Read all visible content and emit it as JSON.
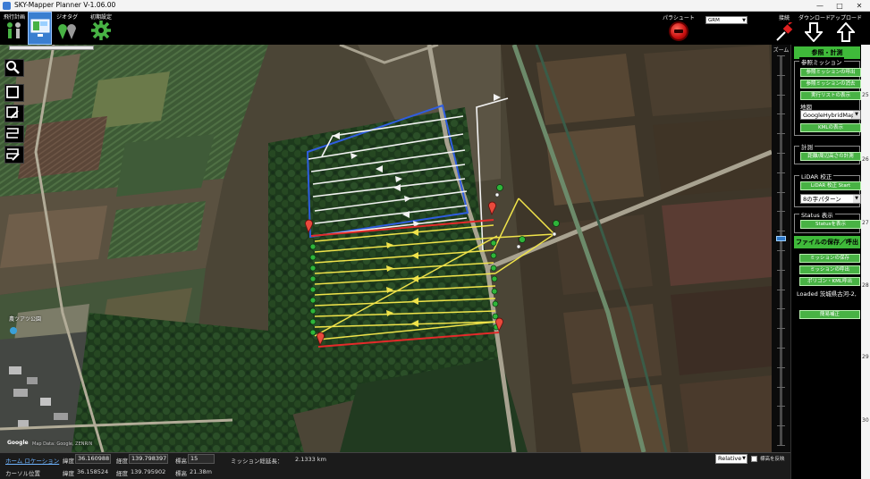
{
  "window": {
    "title": "SKY-Mapper Planner  V-1.06.00",
    "controls": [
      "—",
      "□",
      "✕"
    ]
  },
  "toolbar": {
    "tabs": [
      {
        "label": "飛行計画",
        "icon": "people-pin-icon"
      },
      {
        "label": "",
        "icon": "monitor-icon"
      },
      {
        "label": "ジオタグ",
        "icon": "geotag-pins-icon"
      },
      {
        "label": "初期設定",
        "icon": "gear-icon"
      }
    ],
    "parachute_label": "パラシュート",
    "mode_value": "GRM",
    "connect_label": "接続",
    "download_label": "ダウンロード",
    "upload_label": "アップロード"
  },
  "map": {
    "place_label": "農ツアツ公園",
    "google_label": "Google",
    "attribution": "Map Data: Google, ZENRIN"
  },
  "zoom": {
    "label": "ズーム",
    "level": 0.53
  },
  "panel": {
    "header": "参照・計測",
    "ref_group": {
      "title": "参照ミッション",
      "load_button": "参照ミッションの呼出",
      "clear_button": "参照ミッションの消去",
      "list_button": "実行リストの表示",
      "map_label": "地図",
      "map_select": "GoogleHybridMap",
      "kml_button": "KMLの表示"
    },
    "measure_group": {
      "title": "計測",
      "button": "距離/周辺高さの計測"
    },
    "lidar_group": {
      "title": "LiDAR 校正",
      "start_button": "LiDAR 校正 Start",
      "pattern_select": "8の字パターン"
    },
    "status_group": {
      "title": "Status 表示",
      "button": "Statusを表示"
    },
    "file_header": "ファイルの保存／呼出",
    "save_button": "ミッションの保存",
    "load_button": "ミッションの呼出",
    "polygon_button": "ポリゴン・KML呼出",
    "loaded_text": "Loaded 茨城県古河-2,",
    "calib_button": "簡易補正",
    "edge_numbers": [
      "25",
      "26",
      "27",
      "28",
      "29",
      "30"
    ]
  },
  "status": {
    "home_label": "ホーム ロケーション",
    "home_lat_label": "緯度",
    "home_lat": "36.160988",
    "home_lon_label": "経度",
    "home_lon": "139.798397",
    "home_alt_label": "標高",
    "home_alt": "15",
    "mission_len_label": "ミッション総延長：",
    "mission_len": "2.1333 km",
    "cursor_label": "カーソル位置",
    "cur_lat_label": "緯度",
    "cur_lat": "36.158524",
    "cur_lon_label": "経度",
    "cur_lon": "139.795902",
    "cur_alt_label": "標高",
    "cur_alt": "21.38m",
    "alt_mode": "Relative",
    "reflect_label": "標高を反映"
  }
}
